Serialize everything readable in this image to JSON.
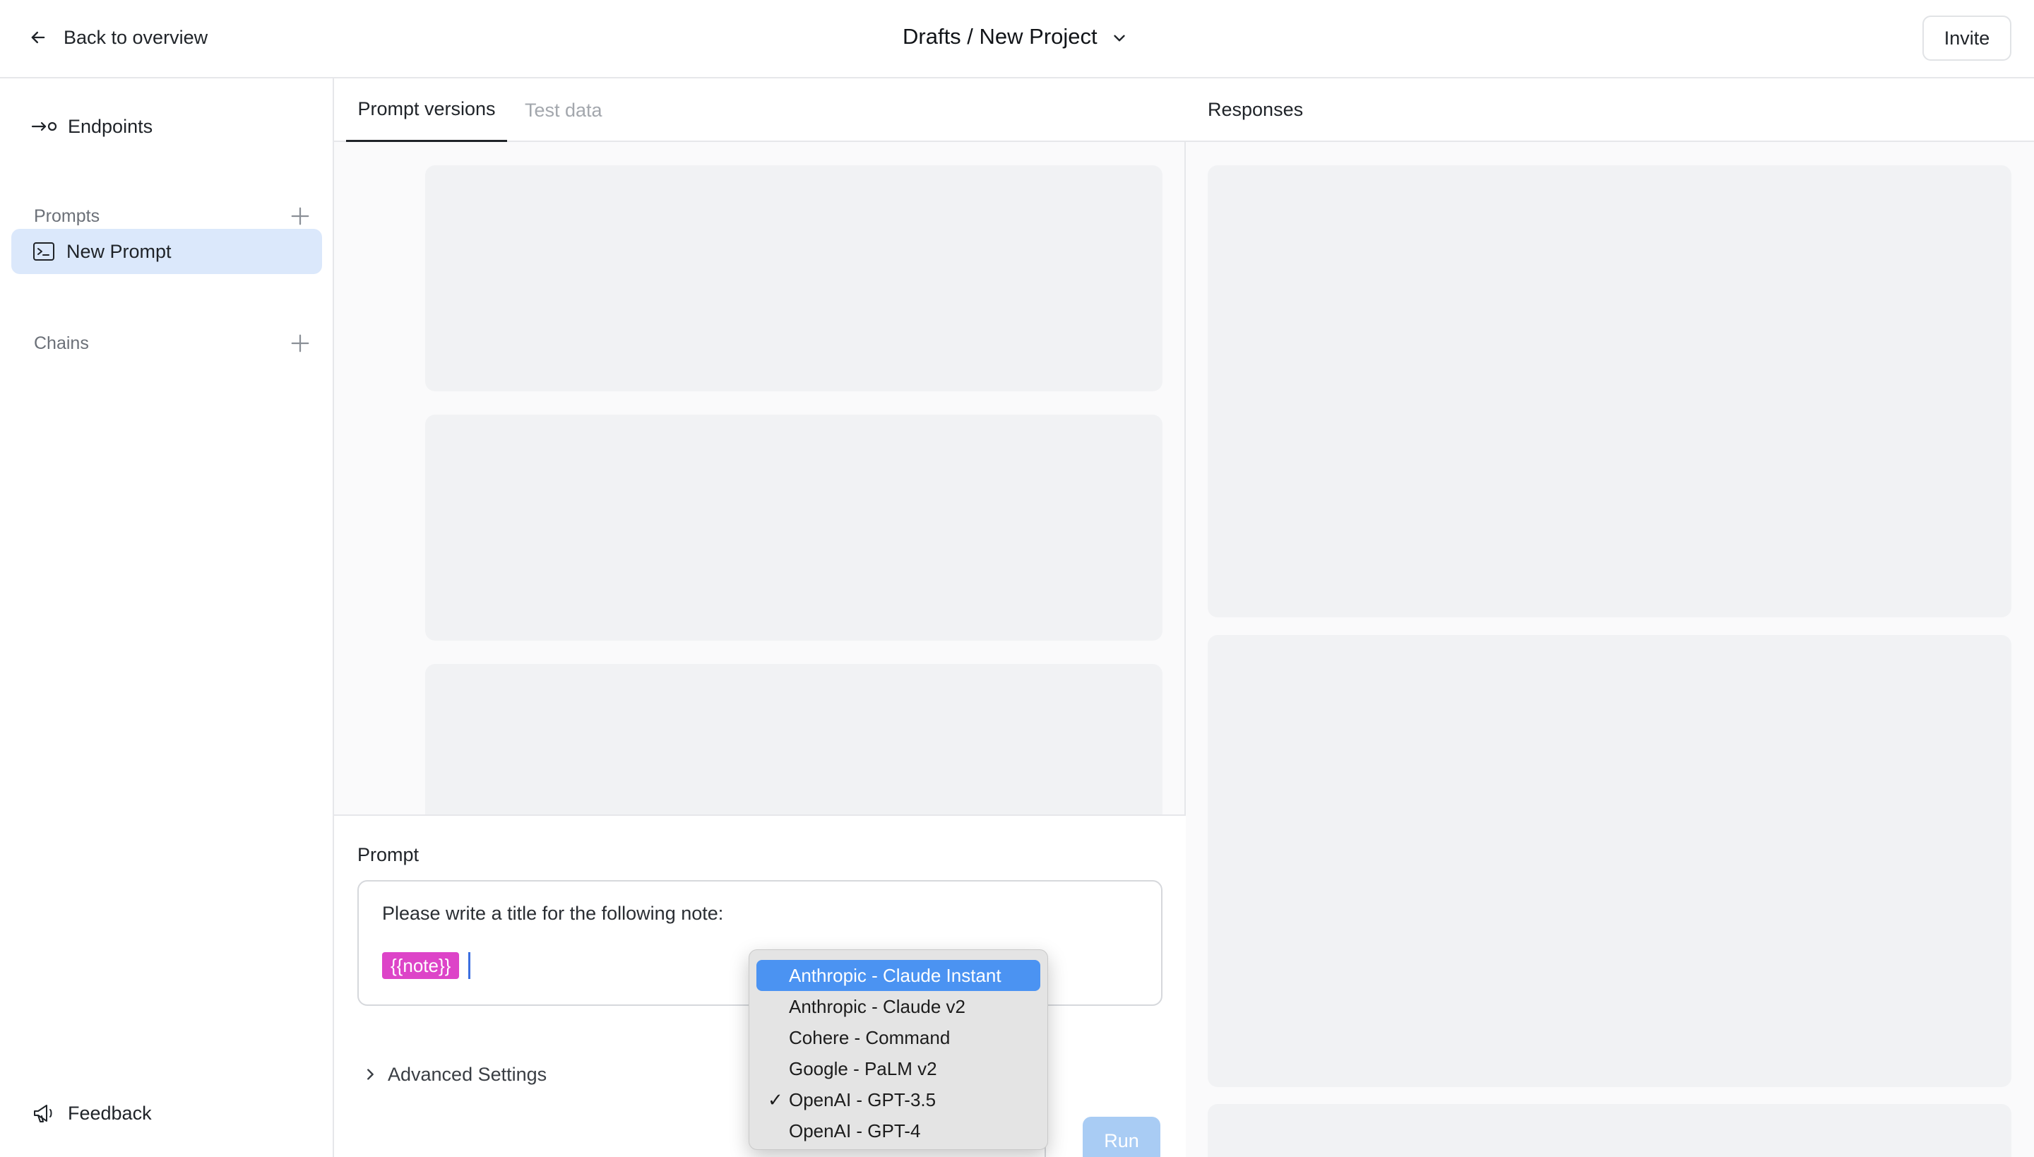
{
  "header": {
    "back_label": "Back to overview",
    "breadcrumb": "Drafts / New Project",
    "invite_label": "Invite"
  },
  "sidebar": {
    "endpoints_label": "Endpoints",
    "prompts_heading": "Prompts",
    "prompts": [
      {
        "label": "New Prompt",
        "active": true
      }
    ],
    "chains_heading": "Chains",
    "feedback_label": "Feedback",
    "active_bg": "#dbe8fb"
  },
  "center": {
    "tabs": [
      {
        "label": "Prompt versions",
        "active": true
      },
      {
        "label": "Test data",
        "active": false
      }
    ],
    "prompt": {
      "label": "Prompt",
      "text": "Please write a title for the following note:",
      "variable": "{{note}}",
      "variable_color": "#dd44c8",
      "advanced_label": "Advanced Settings",
      "run_label": "Run",
      "run_color": "#a9ccf4"
    }
  },
  "right": {
    "title": "Responses"
  },
  "model_dropdown": {
    "highlight_color": "#4b93f2",
    "selected_index": 4,
    "highlighted_index": 0,
    "options": [
      "Anthropic - Claude Instant",
      "Anthropic - Claude v2",
      "Cohere - Command",
      "Google - PaLM v2",
      "OpenAI - GPT-3.5",
      "OpenAI - GPT-4"
    ]
  }
}
